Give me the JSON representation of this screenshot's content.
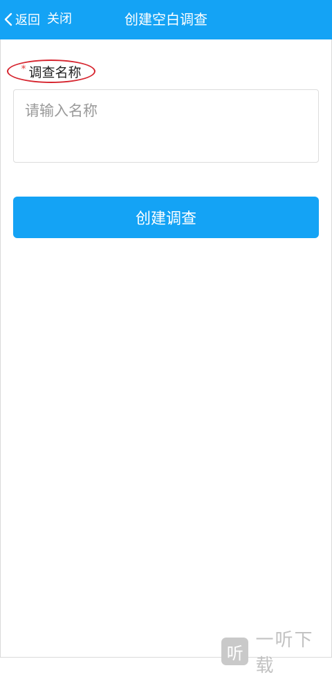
{
  "header": {
    "back_label": "返回",
    "close_label": "关闭",
    "title": "创建空白调查",
    "background_color": "#14a3f5"
  },
  "form": {
    "required_mark": "*",
    "name_label": "调查名称",
    "name_placeholder": "请输入名称",
    "name_value": "",
    "submit_label": "创建调查",
    "highlight_color": "#d6242e"
  },
  "watermark": {
    "icon_char": "听",
    "text": "一听下载"
  },
  "icons": [
    "chevron-left-icon",
    "watermark-logo-icon"
  ]
}
